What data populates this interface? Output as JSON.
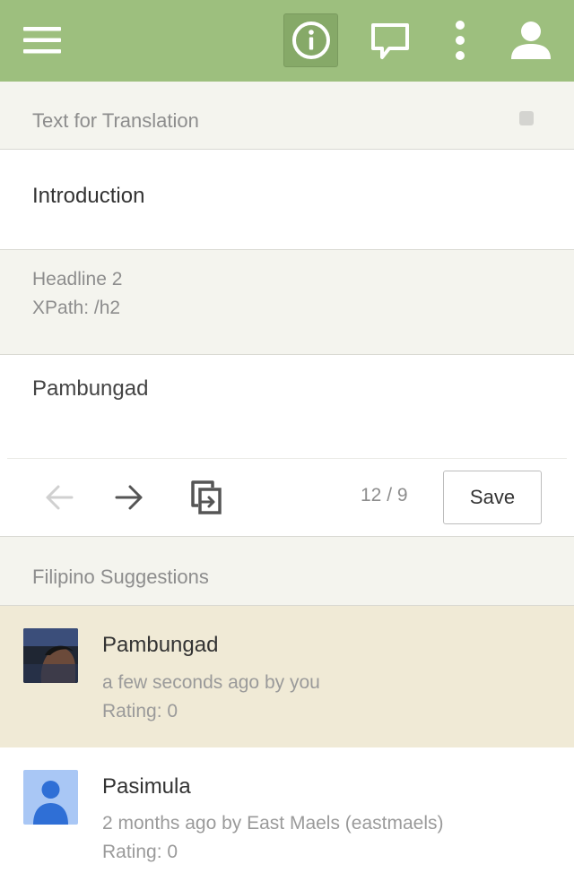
{
  "toolbar": {
    "menu_icon": "hamburger-menu-icon",
    "info_icon": "info-circle-icon",
    "comment_icon": "comment-bubble-icon",
    "more_icon": "vertical-dots-icon",
    "user_icon": "user-profile-icon",
    "bar_color": "#9dbf7e"
  },
  "source": {
    "header": "Text for Translation",
    "text": "Introduction",
    "element_type": "Headline 2",
    "xpath": "XPath: /h2"
  },
  "translation": {
    "text": "Pambungad",
    "counter": "12 / 9",
    "save_label": "Save"
  },
  "suggestions": {
    "header": "Filipino Suggestions",
    "items": [
      {
        "title": "Pambungad",
        "meta": "a few seconds ago by you",
        "rating": "Rating: 0",
        "active_bg": "#f0ead6"
      },
      {
        "title": "Pasimula",
        "meta": "2 months ago by East Maels (eastmaels)",
        "rating": "Rating: 0"
      }
    ]
  }
}
